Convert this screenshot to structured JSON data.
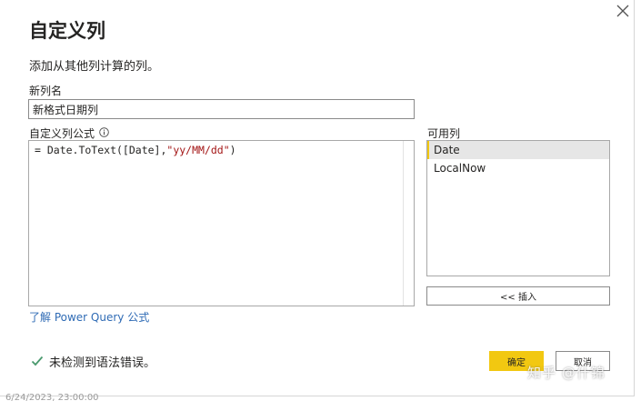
{
  "dialog": {
    "title": "自定义列",
    "subtitle": "添加从其他列计算的列。",
    "new_column_label": "新列名",
    "new_column_value": "新格式日期列",
    "formula_label": "自定义列公式",
    "formula": {
      "prefix": "= Date.ToText([Date],",
      "string": "\"yy/MM/dd\"",
      "suffix": ")"
    },
    "available_columns_label": "可用列",
    "available_columns": [
      {
        "label": "Date",
        "selected": true
      },
      {
        "label": "LocalNow",
        "selected": false
      }
    ],
    "insert_label": "<< 插入",
    "learn_link": "了解 Power Query 公式",
    "status_text": "未检测到语法错误。",
    "ok_label": "确定",
    "cancel_label": "取消"
  },
  "icons": {
    "close": "close-icon",
    "info": "info-icon",
    "check": "checkmark-icon"
  },
  "colors": {
    "accent": "#f2c811",
    "link": "#2f6bb5",
    "status_ok": "#4a9a6e",
    "string_literal": "#a31515"
  },
  "watermark": "知乎 @什锦",
  "background_text": "6/24/2023, 23:00:00"
}
